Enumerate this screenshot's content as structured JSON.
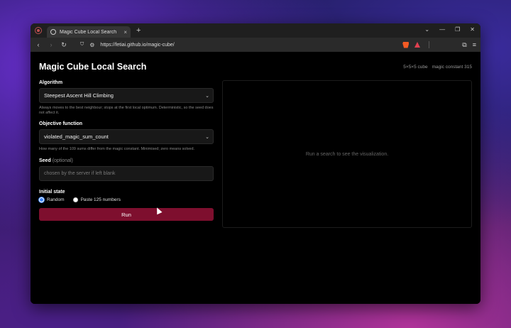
{
  "browser": {
    "tab_title": "Magic Cube Local Search",
    "tab_close": "×",
    "new_tab": "+",
    "url": "https://fetiai.github.io/magic-cube/",
    "window_controls": [
      "⌄",
      "—",
      "❐",
      "✕"
    ],
    "nav": {
      "back": "‹",
      "forward": "›",
      "reload": "↻",
      "bookmark": "⛉",
      "tune": "⚙",
      "puzzle": "⧉",
      "menu": "≡"
    }
  },
  "page": {
    "title": "Magic Cube Local Search",
    "meta_size": "5×5×5 cube",
    "meta_constant": "magic constant 315",
    "algorithm": {
      "label": "Algorithm",
      "value": "Steepest Ascent Hill Climbing",
      "help": "Always moves to the best neighbour; stops at the first local optimum. Deterministic, so the seed does not affect it."
    },
    "objective": {
      "label": "Objective function",
      "value": "violated_magic_sum_count",
      "help": "How many of the 109 sums differ from the magic constant. Minimised; zero means solved."
    },
    "seed": {
      "label": "Seed",
      "optional": "(optional)",
      "placeholder": "chosen by the server if left blank"
    },
    "initial_state": {
      "label": "Initial state",
      "random": "Random",
      "paste": "Paste 125 numbers",
      "selected": "Random"
    },
    "run_label": "Run",
    "viz_placeholder": "Run a search to see the visualization."
  },
  "colors": {
    "accent": "#7e0f2e",
    "radio": "#3b82f6"
  }
}
